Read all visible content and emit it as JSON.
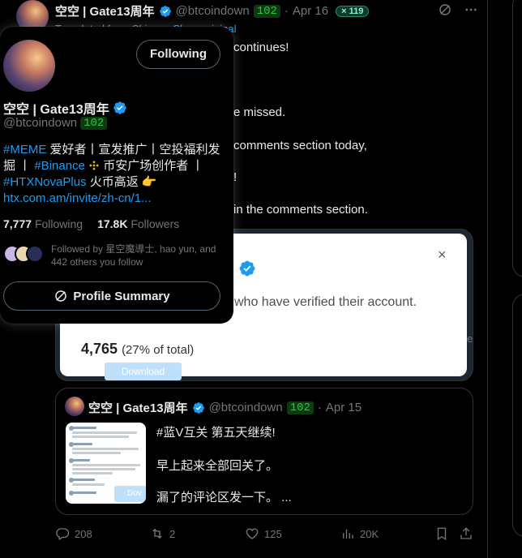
{
  "tweet": {
    "author_name": "空空 | Gate13周年",
    "handle": "@btcoindown",
    "badge_number": "102",
    "dot": "·",
    "date": "Apr 16",
    "pill": "× 119",
    "translated_prefix": "Translated from Chinese",
    "translated_link": "Show original",
    "body": [
      "continues!",
      "e missed.",
      "comments section today,",
      "!",
      "in the comments section."
    ]
  },
  "verified_card": {
    "text": "who have verified their account.",
    "count": "4,765",
    "percent": "(27% of total)",
    "download": "Download",
    "close": "×",
    "edge_char": "e"
  },
  "quote": {
    "author_name": "空空 | Gate13周年",
    "handle": "@btcoindown",
    "badge_number": "102",
    "dot": "·",
    "date": "Apr 15",
    "thumb_button": "Dov",
    "lines": [
      "#蓝V互关 第五天继续!",
      "早上起来全部回关了。",
      "漏了的评论区发一下。  ..."
    ]
  },
  "actions": {
    "replies": "208",
    "reposts": "2",
    "likes": "125",
    "views": "20K"
  },
  "hover_card": {
    "follow_button": "Following",
    "name": "空空 | Gate13周年",
    "handle": "@btcoindown",
    "badge_number": "102",
    "bio_l1_tag": "#MEME",
    "bio_l1_text": " 爱好者丨宣发推广丨空投福利发",
    "bio_l2_a": "掘 丨 ",
    "bio_l2_tag": "#Binance",
    "bio_l2_b": " 币安广场创作者 丨",
    "bio_l3_tag": "#HTXNovaPlus",
    "bio_l3_text": "  火币高返 👉",
    "bio_link": "htx.com.am/invite/zh-cn/1...",
    "following_count": "7,777",
    "following_label": "Following",
    "followers_count": "17.8K",
    "followers_label": "Followers",
    "followed_by": "Followed by 星空魔導士, hao yun, and 442 others you follow",
    "summary_button": "Profile Summary"
  },
  "colors": {
    "accent": "#1d9bf0",
    "background": "#000000",
    "muted": "#71767b",
    "badge_green": "#27c93f"
  },
  "icons": [
    "verified-badge-icon",
    "grok-icon",
    "more-icon",
    "close-icon",
    "binance-icon",
    "reply-icon",
    "repost-icon",
    "like-icon",
    "views-icon",
    "bookmark-icon",
    "share-icon"
  ]
}
